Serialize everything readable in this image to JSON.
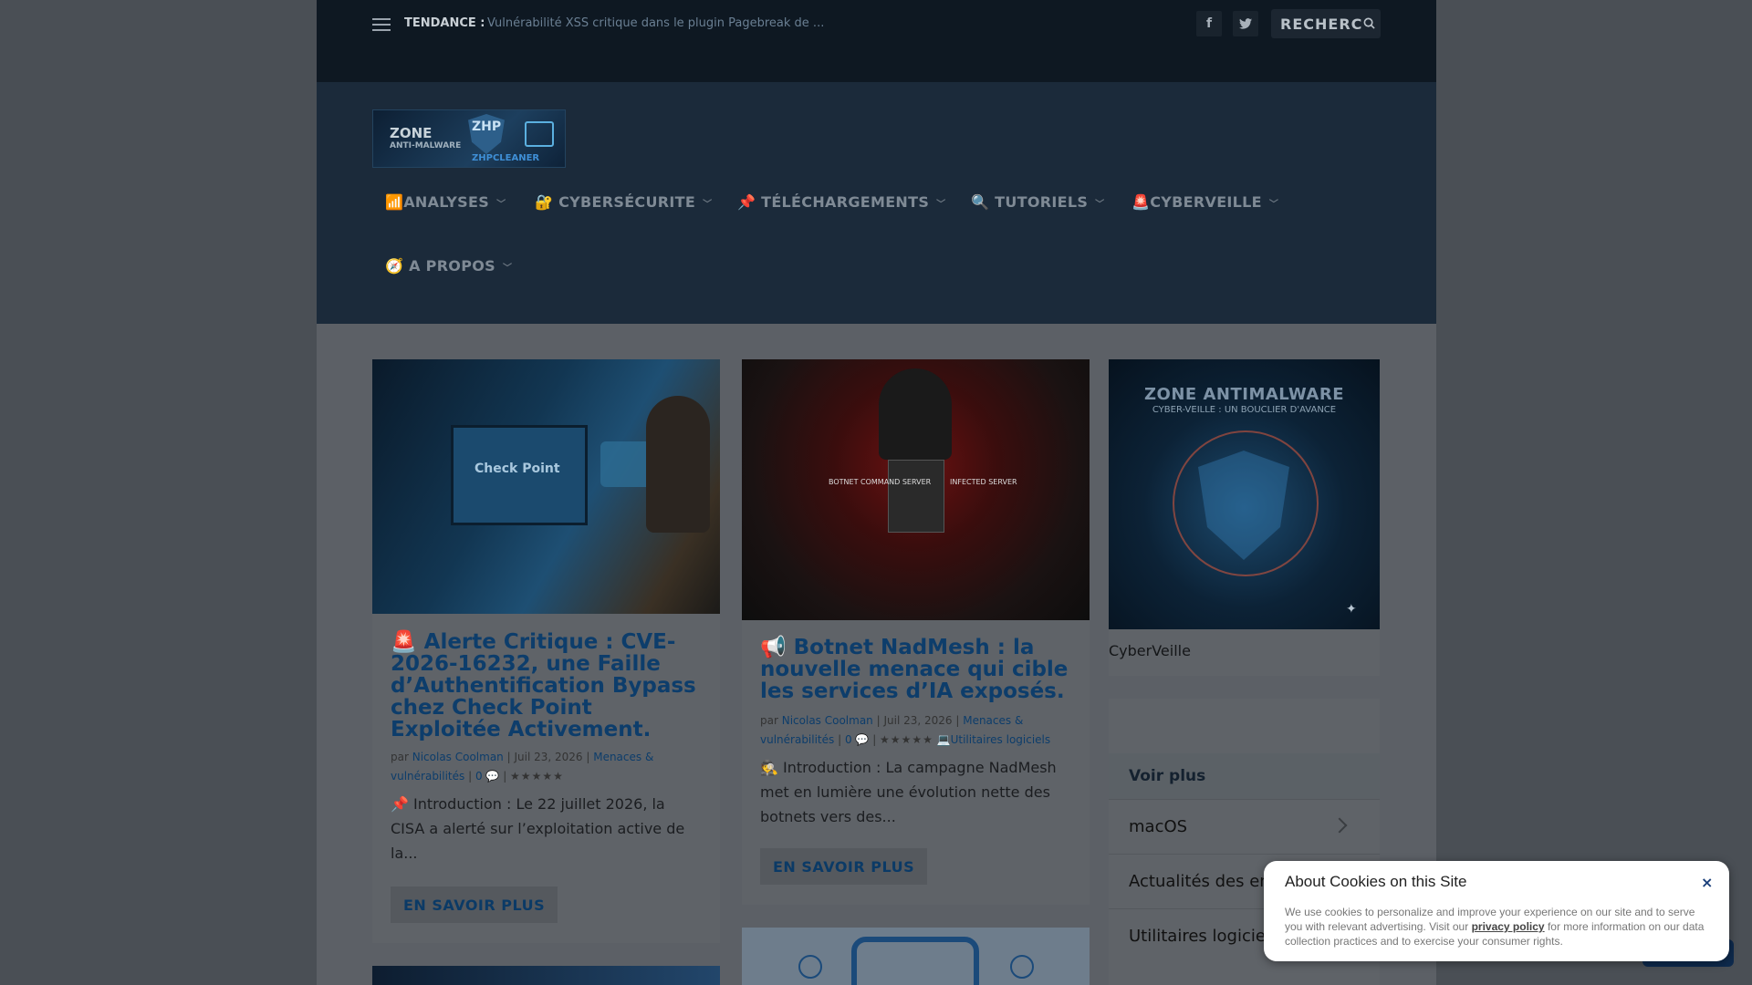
{
  "topbar": {
    "trend_label": "TENDANCE :",
    "trend_text": "Vulnérabilité XSS critique dans le plugin Pagebreak de ...",
    "search_label": "RECHERC"
  },
  "nav": {
    "items": [
      {
        "icon": "📶",
        "label": "ANALYSES"
      },
      {
        "icon": "🔐",
        "label": "CYBERSÉCURITE"
      },
      {
        "icon": "📌",
        "label": "TÉLÉCHARGEMENTS"
      },
      {
        "icon": "🔍",
        "label": "TUTORIELS"
      },
      {
        "icon": "🚨",
        "label": "CYBERVEILLE"
      },
      {
        "icon": "🧭",
        "label": "A PROPOS"
      }
    ]
  },
  "logo": {
    "line1": "ZONE",
    "line2": "ANTI-MALWARE",
    "badge": "ZHP",
    "sub": "ZHPCLEANER"
  },
  "articles": [
    {
      "title": "🚨 Alerte Critique : CVE-2026-16232, une Faille d’Authentification Bypass chez Check Point Exploitée Activement.",
      "meta_by": "par",
      "author": "Nicolas Coolman",
      "date": "Juil 23, 2026",
      "category": "Menaces & vulnérabilités",
      "comments": "0",
      "excerpt": "📌 Introduction : Le 22 juillet 2026, la CISA a alerté sur l’exploitation active de la...",
      "button": "EN SAVOIR PLUS",
      "image_text": "Check Point"
    },
    {
      "title": "📢 Botnet NadMesh : la nouvelle menace qui cible les services d’IA exposés.",
      "meta_by": "par",
      "author": "Nicolas Coolman",
      "date": "Juil 23, 2026",
      "category": "Menaces & vulnérabilités",
      "comments": "0",
      "category2": "💻Utilitaires logiciels",
      "excerpt": "🕵️ Introduction : La campagne NadMesh met en lumière une évolution nette des botnets vers des...",
      "button": "EN SAVOIR PLUS",
      "image_labels": [
        "BOTNET COMMAND SERVER",
        "INFECTED SERVER"
      ]
    }
  ],
  "sidebar": {
    "promo_title": "ZONE ANTIMALWARE",
    "promo_sub": "CYBER-VEILLE : UN BOUCLIER D'AVANCE",
    "promo_caption": "CyberVeille",
    "voir_plus": "Voir plus",
    "items": [
      "macOS",
      "Actualités des entr",
      "Utilitaires logiciels"
    ]
  },
  "cookie": {
    "title": "About Cookies on this Site",
    "close": "×",
    "text_before": "We use cookies to personalize and improve your experience on our site and to serve you with relevant advertising. Visit our",
    "link": "privacy policy",
    "text_after": "for more information on our data collection practices and to exercise your consumer rights."
  }
}
